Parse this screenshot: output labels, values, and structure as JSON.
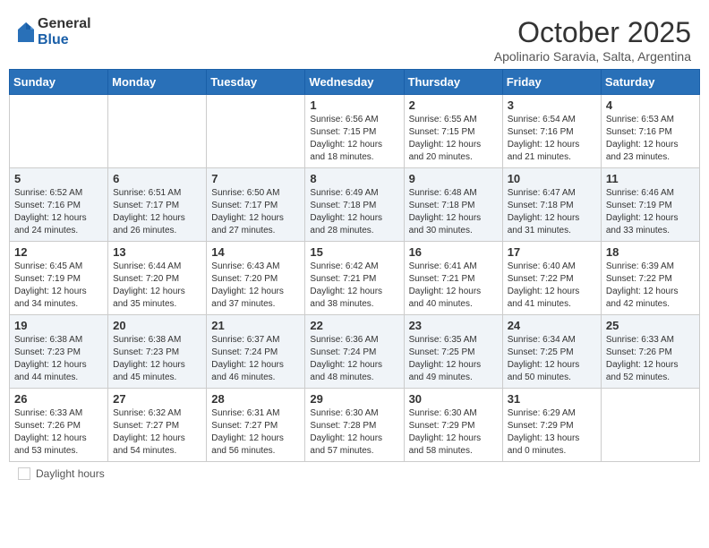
{
  "logo": {
    "general": "General",
    "blue": "Blue"
  },
  "header": {
    "month": "October 2025",
    "subtitle": "Apolinario Saravia, Salta, Argentina"
  },
  "days_of_week": [
    "Sunday",
    "Monday",
    "Tuesday",
    "Wednesday",
    "Thursday",
    "Friday",
    "Saturday"
  ],
  "footer": {
    "legend_label": "Daylight hours"
  },
  "weeks": [
    {
      "cells": [
        {
          "empty": true
        },
        {
          "empty": true
        },
        {
          "empty": true
        },
        {
          "day": 1,
          "sunrise": "6:56 AM",
          "sunset": "7:15 PM",
          "daylight": "12 hours and 18 minutes."
        },
        {
          "day": 2,
          "sunrise": "6:55 AM",
          "sunset": "7:15 PM",
          "daylight": "12 hours and 20 minutes."
        },
        {
          "day": 3,
          "sunrise": "6:54 AM",
          "sunset": "7:16 PM",
          "daylight": "12 hours and 21 minutes."
        },
        {
          "day": 4,
          "sunrise": "6:53 AM",
          "sunset": "7:16 PM",
          "daylight": "12 hours and 23 minutes."
        }
      ]
    },
    {
      "cells": [
        {
          "day": 5,
          "sunrise": "6:52 AM",
          "sunset": "7:16 PM",
          "daylight": "12 hours and 24 minutes."
        },
        {
          "day": 6,
          "sunrise": "6:51 AM",
          "sunset": "7:17 PM",
          "daylight": "12 hours and 26 minutes."
        },
        {
          "day": 7,
          "sunrise": "6:50 AM",
          "sunset": "7:17 PM",
          "daylight": "12 hours and 27 minutes."
        },
        {
          "day": 8,
          "sunrise": "6:49 AM",
          "sunset": "7:18 PM",
          "daylight": "12 hours and 28 minutes."
        },
        {
          "day": 9,
          "sunrise": "6:48 AM",
          "sunset": "7:18 PM",
          "daylight": "12 hours and 30 minutes."
        },
        {
          "day": 10,
          "sunrise": "6:47 AM",
          "sunset": "7:18 PM",
          "daylight": "12 hours and 31 minutes."
        },
        {
          "day": 11,
          "sunrise": "6:46 AM",
          "sunset": "7:19 PM",
          "daylight": "12 hours and 33 minutes."
        }
      ]
    },
    {
      "cells": [
        {
          "day": 12,
          "sunrise": "6:45 AM",
          "sunset": "7:19 PM",
          "daylight": "12 hours and 34 minutes."
        },
        {
          "day": 13,
          "sunrise": "6:44 AM",
          "sunset": "7:20 PM",
          "daylight": "12 hours and 35 minutes."
        },
        {
          "day": 14,
          "sunrise": "6:43 AM",
          "sunset": "7:20 PM",
          "daylight": "12 hours and 37 minutes."
        },
        {
          "day": 15,
          "sunrise": "6:42 AM",
          "sunset": "7:21 PM",
          "daylight": "12 hours and 38 minutes."
        },
        {
          "day": 16,
          "sunrise": "6:41 AM",
          "sunset": "7:21 PM",
          "daylight": "12 hours and 40 minutes."
        },
        {
          "day": 17,
          "sunrise": "6:40 AM",
          "sunset": "7:22 PM",
          "daylight": "12 hours and 41 minutes."
        },
        {
          "day": 18,
          "sunrise": "6:39 AM",
          "sunset": "7:22 PM",
          "daylight": "12 hours and 42 minutes."
        }
      ]
    },
    {
      "cells": [
        {
          "day": 19,
          "sunrise": "6:38 AM",
          "sunset": "7:23 PM",
          "daylight": "12 hours and 44 minutes."
        },
        {
          "day": 20,
          "sunrise": "6:38 AM",
          "sunset": "7:23 PM",
          "daylight": "12 hours and 45 minutes."
        },
        {
          "day": 21,
          "sunrise": "6:37 AM",
          "sunset": "7:24 PM",
          "daylight": "12 hours and 46 minutes."
        },
        {
          "day": 22,
          "sunrise": "6:36 AM",
          "sunset": "7:24 PM",
          "daylight": "12 hours and 48 minutes."
        },
        {
          "day": 23,
          "sunrise": "6:35 AM",
          "sunset": "7:25 PM",
          "daylight": "12 hours and 49 minutes."
        },
        {
          "day": 24,
          "sunrise": "6:34 AM",
          "sunset": "7:25 PM",
          "daylight": "12 hours and 50 minutes."
        },
        {
          "day": 25,
          "sunrise": "6:33 AM",
          "sunset": "7:26 PM",
          "daylight": "12 hours and 52 minutes."
        }
      ]
    },
    {
      "cells": [
        {
          "day": 26,
          "sunrise": "6:33 AM",
          "sunset": "7:26 PM",
          "daylight": "12 hours and 53 minutes."
        },
        {
          "day": 27,
          "sunrise": "6:32 AM",
          "sunset": "7:27 PM",
          "daylight": "12 hours and 54 minutes."
        },
        {
          "day": 28,
          "sunrise": "6:31 AM",
          "sunset": "7:27 PM",
          "daylight": "12 hours and 56 minutes."
        },
        {
          "day": 29,
          "sunrise": "6:30 AM",
          "sunset": "7:28 PM",
          "daylight": "12 hours and 57 minutes."
        },
        {
          "day": 30,
          "sunrise": "6:30 AM",
          "sunset": "7:29 PM",
          "daylight": "12 hours and 58 minutes."
        },
        {
          "day": 31,
          "sunrise": "6:29 AM",
          "sunset": "7:29 PM",
          "daylight": "13 hours and 0 minutes."
        },
        {
          "empty": true
        }
      ]
    }
  ]
}
